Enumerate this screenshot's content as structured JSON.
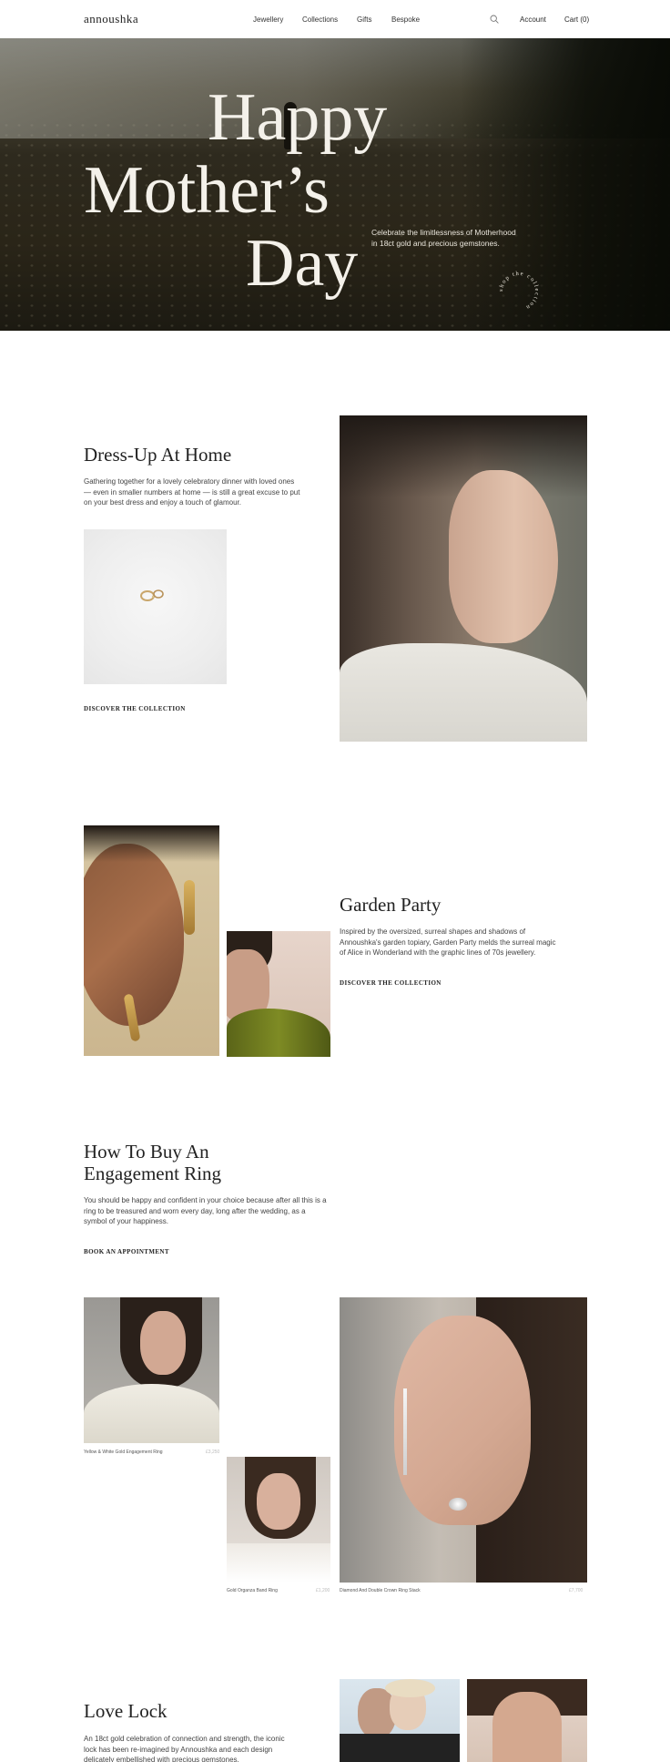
{
  "header": {
    "logo": "annoushka",
    "nav": [
      "Jewellery",
      "Collections",
      "Gifts",
      "Bespoke"
    ],
    "search_icon": "search-icon",
    "account": "Account",
    "cart": "Cart (0)"
  },
  "hero": {
    "title_line1": "Happy",
    "title_line2": "Mother’s",
    "title_line3": "Day",
    "subtitle": "Celebrate the limitlessness of Motherhood in 18ct gold and precious gemstones.",
    "badge_text": "shop the collection"
  },
  "dress_up": {
    "title": "Dress-Up At Home",
    "body": "Gathering together for a lovely celebratory dinner with loved ones — even in smaller numbers at home — is still a great excuse to put on your best dress and enjoy a touch of glamour.",
    "cta": "DISCOVER THE COLLECTION"
  },
  "garden": {
    "title": "Garden Party",
    "body": "Inspired by the oversized, surreal shapes and shadows of Annoushka's garden topiary, Garden Party melds the surreal magic of Alice in Wonderland with the graphic lines of 70s jewellery.",
    "cta": "DISCOVER THE COLLECTION"
  },
  "engagement": {
    "title_line1": "How To Buy An",
    "title_line2": "Engagement Ring",
    "body": "You should be happy and confident in your choice because after all this is a ring to be treasured and worn every day, long after the wedding, as a symbol of your happiness.",
    "cta": "BOOK AN APPOINTMENT",
    "products": [
      {
        "name": "Yellow & White Gold Engagement Ring",
        "price": "£3,250"
      },
      {
        "name": "Gold Organza Band Ring",
        "price": "£1,200"
      },
      {
        "name": "Diamond And Double Crown Ring Stack",
        "price": "£7,700"
      }
    ]
  },
  "love_lock": {
    "title": "Love Lock",
    "body": "An 18ct gold celebration of connection and strength, the iconic lock has been re-imagined by Annoushka and each design delicately embellished with precious gemstones."
  }
}
